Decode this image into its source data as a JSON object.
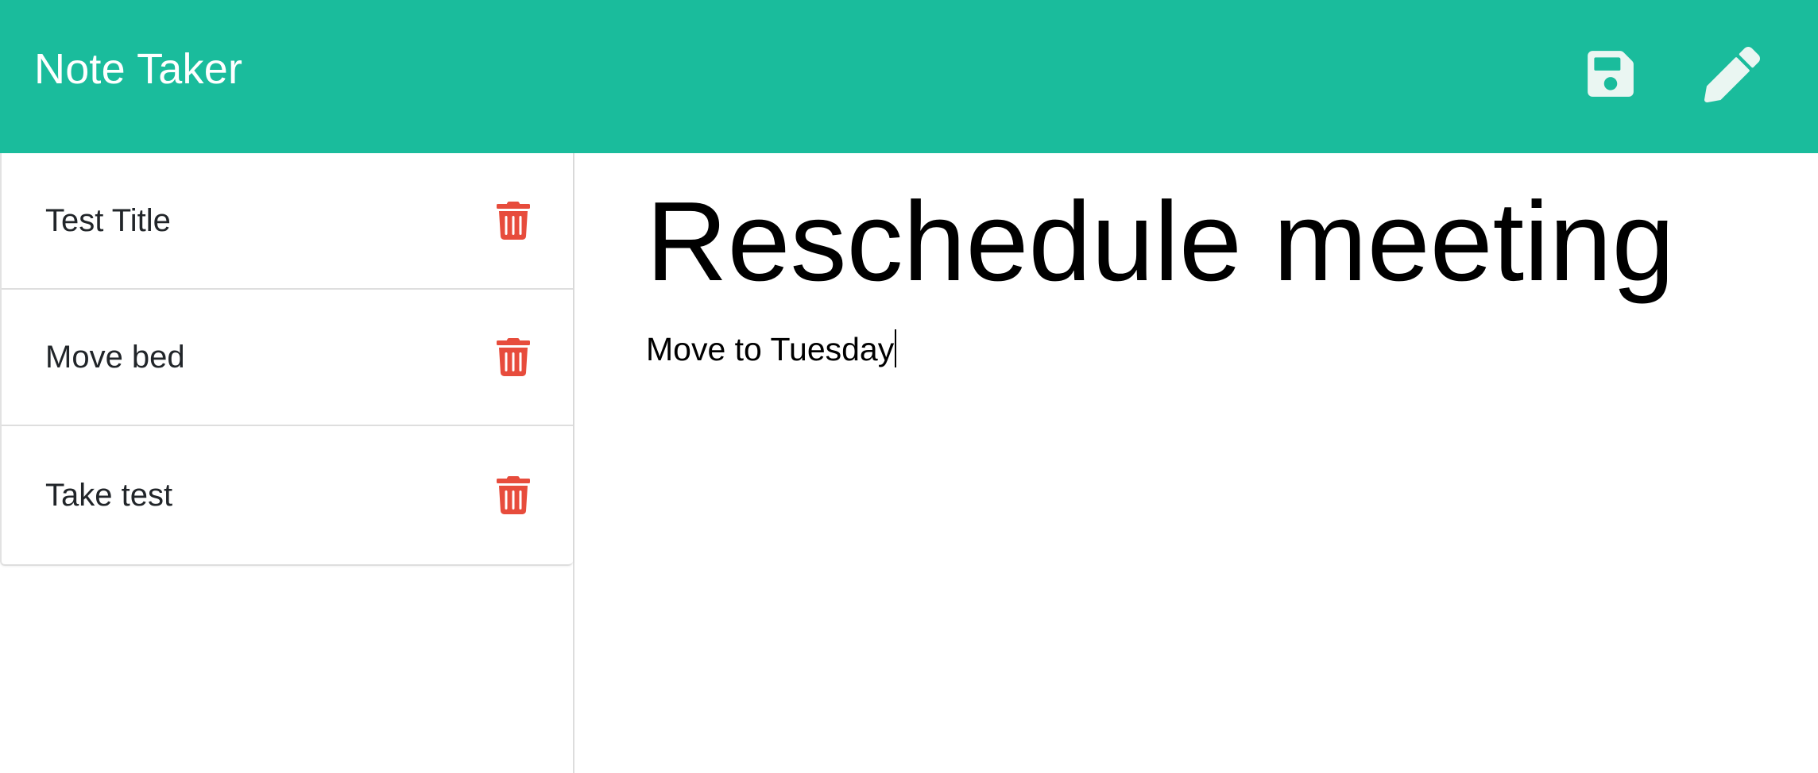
{
  "app": {
    "title": "Note Taker"
  },
  "toolbar": {
    "save_icon": "floppy-disk-icon",
    "edit_icon": "pencil-icon"
  },
  "sidebar": {
    "notes": [
      {
        "title": "Test Title"
      },
      {
        "title": "Move bed"
      },
      {
        "title": "Take test"
      }
    ],
    "delete_icon": "trash-icon"
  },
  "editor": {
    "title": "Reschedule meeting",
    "body": "Move to Tuesday"
  },
  "colors": {
    "brand": "#1abc9c",
    "delete": "#e74c3c",
    "icon_light": "#eaf6f2"
  }
}
